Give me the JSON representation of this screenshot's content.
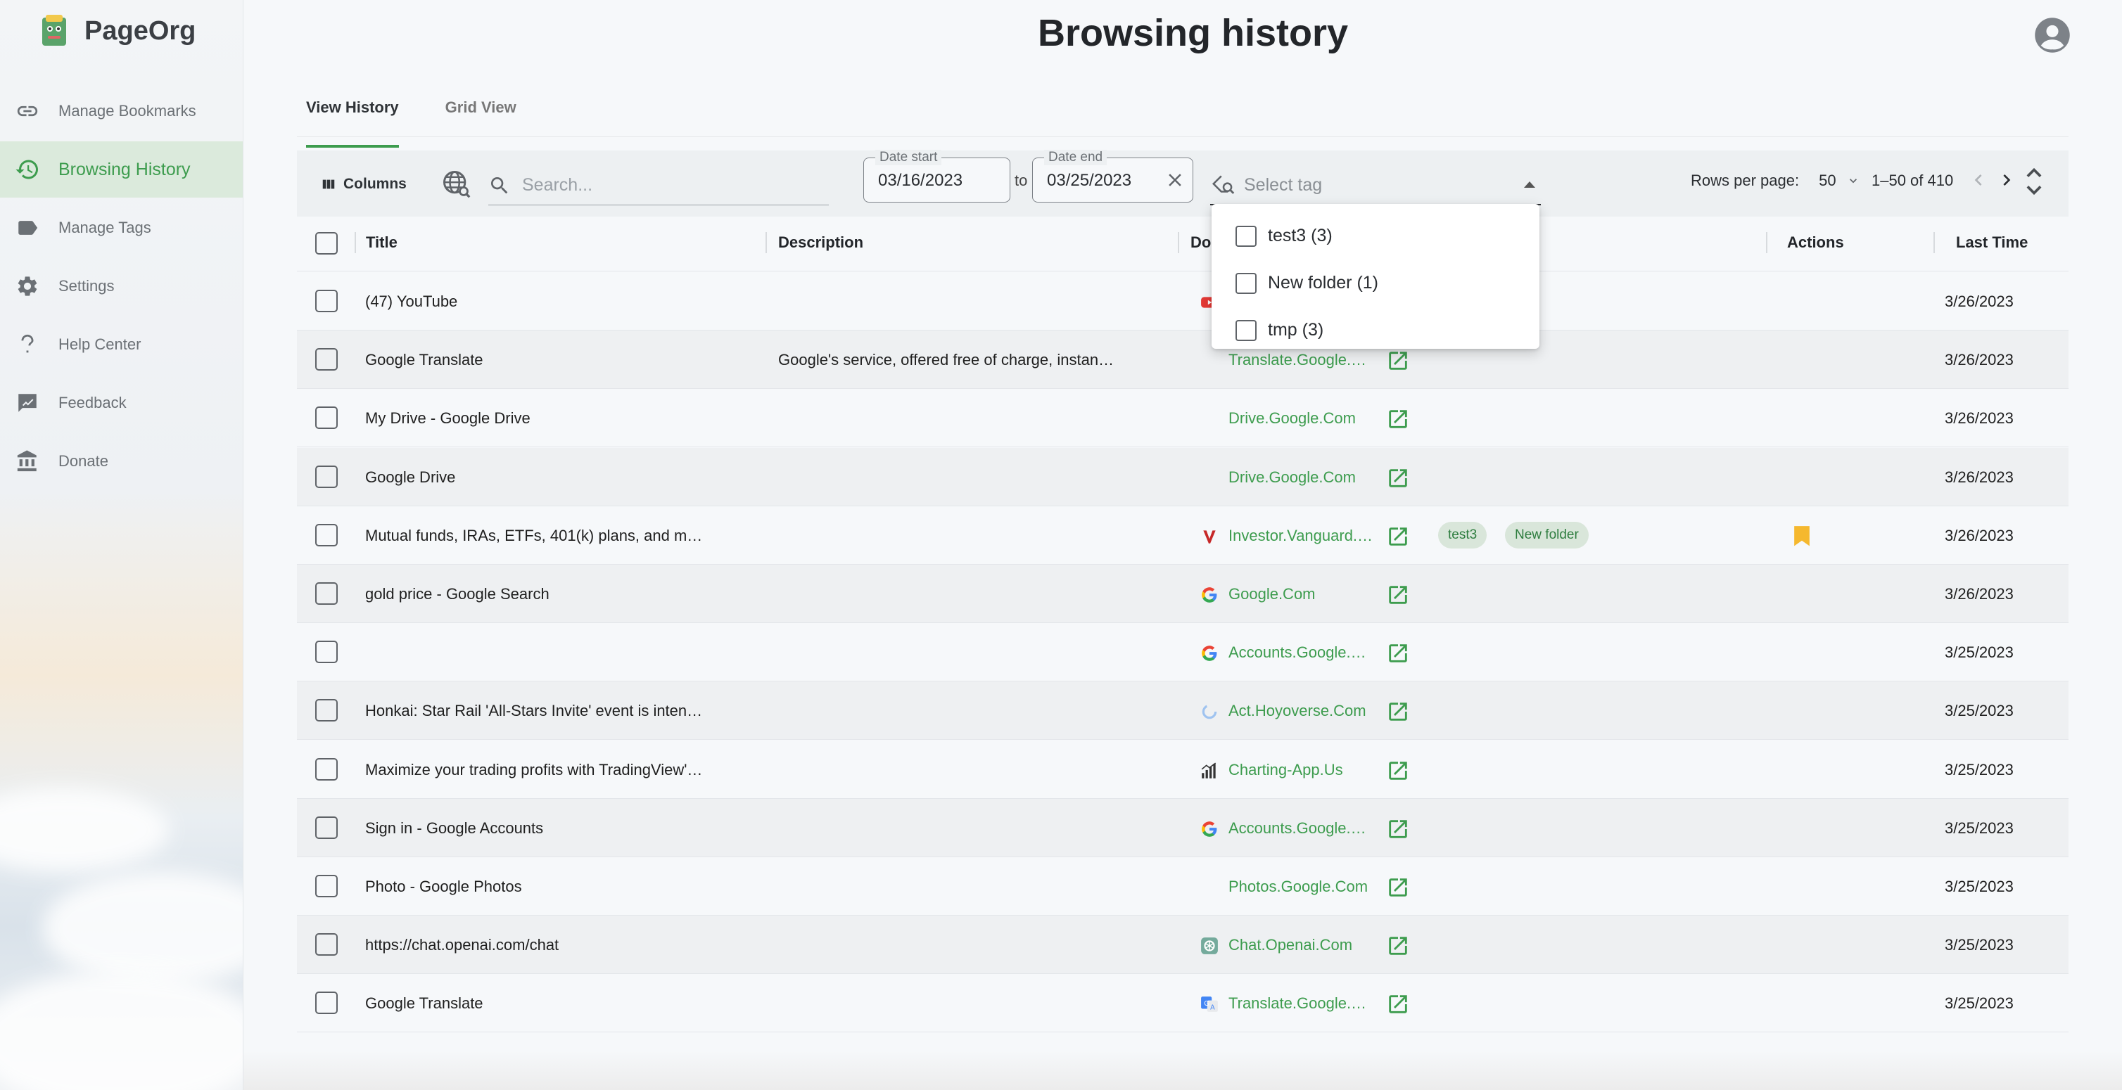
{
  "app": {
    "name": "PageOrg"
  },
  "nav": {
    "items": [
      {
        "label": "Manage Bookmarks",
        "icon": "link-icon",
        "active": false
      },
      {
        "label": "Browsing History",
        "icon": "history-icon",
        "active": true
      },
      {
        "label": "Manage Tags",
        "icon": "tag-icon",
        "active": false
      },
      {
        "label": "Settings",
        "icon": "gear-icon",
        "active": false
      },
      {
        "label": "Help Center",
        "icon": "question-icon",
        "active": false
      },
      {
        "label": "Feedback",
        "icon": "feedback-icon",
        "active": false
      },
      {
        "label": "Donate",
        "icon": "bank-icon",
        "active": false
      }
    ]
  },
  "header": {
    "title": "Browsing history"
  },
  "tabs": [
    {
      "label": "View History",
      "active": true
    },
    {
      "label": "Grid View",
      "active": false
    }
  ],
  "toolbar": {
    "columns_label": "Columns",
    "search_placeholder": "Search...",
    "date_start_label": "Date start",
    "date_start_value": "03/16/2023",
    "to_label": "to",
    "date_end_label": "Date end",
    "date_end_value": "03/25/2023",
    "tag_placeholder": "Select tag",
    "rows_per_page_label": "Rows per page:",
    "rows_per_page_value": "50",
    "range": "1–50 of 410"
  },
  "tag_dropdown": {
    "options": [
      "test3 (3)",
      "New folder (1)",
      "tmp (3)"
    ]
  },
  "table": {
    "columns": [
      "Title",
      "Description",
      "Do",
      "Actions",
      "Last Time"
    ],
    "rows": [
      {
        "title": "(47) YouTube",
        "description": "",
        "domain": "",
        "favicon": "youtube",
        "tags": [],
        "bookmarked": false,
        "last_time": "3/26/2023"
      },
      {
        "title": "Google Translate",
        "description": "Google's service, offered free of charge, instan…",
        "domain": "Translate.Google.…",
        "favicon": "",
        "tags": [],
        "bookmarked": false,
        "last_time": "3/26/2023"
      },
      {
        "title": "My Drive - Google Drive",
        "description": "",
        "domain": "Drive.Google.Com",
        "favicon": "",
        "tags": [],
        "bookmarked": false,
        "last_time": "3/26/2023"
      },
      {
        "title": "Google Drive",
        "description": "",
        "domain": "Drive.Google.Com",
        "favicon": "",
        "tags": [],
        "bookmarked": false,
        "last_time": "3/26/2023"
      },
      {
        "title": "Mutual funds, IRAs, ETFs, 401(k) plans, and m…",
        "description": "",
        "domain": "Investor.Vanguard.…",
        "favicon": "vanguard",
        "tags": [
          "test3",
          "New folder"
        ],
        "bookmarked": true,
        "last_time": "3/26/2023"
      },
      {
        "title": "gold price - Google Search",
        "description": "",
        "domain": "Google.Com",
        "favicon": "google",
        "tags": [],
        "bookmarked": false,
        "last_time": "3/26/2023"
      },
      {
        "title": "",
        "description": "",
        "domain": "Accounts.Google.…",
        "favicon": "google",
        "tags": [],
        "bookmarked": false,
        "last_time": "3/25/2023"
      },
      {
        "title": "Honkai: Star Rail 'All-Stars Invite' event is inten…",
        "description": "",
        "domain": "Act.Hoyoverse.Com",
        "favicon": "hoyoverse",
        "tags": [],
        "bookmarked": false,
        "last_time": "3/25/2023"
      },
      {
        "title": "Maximize your trading profits with TradingView'…",
        "description": "",
        "domain": "Charting-App.Us",
        "favicon": "chart",
        "tags": [],
        "bookmarked": false,
        "last_time": "3/25/2023"
      },
      {
        "title": "Sign in - Google Accounts",
        "description": "",
        "domain": "Accounts.Google.…",
        "favicon": "google",
        "tags": [],
        "bookmarked": false,
        "last_time": "3/25/2023"
      },
      {
        "title": "Photo - Google Photos",
        "description": "",
        "domain": "Photos.Google.Com",
        "favicon": "",
        "tags": [],
        "bookmarked": false,
        "last_time": "3/25/2023"
      },
      {
        "title": "https://chat.openai.com/chat",
        "description": "",
        "domain": "Chat.Openai.Com",
        "favicon": "openai",
        "tags": [],
        "bookmarked": false,
        "last_time": "3/25/2023"
      },
      {
        "title": "Google Translate",
        "description": "",
        "domain": "Translate.Google.…",
        "favicon": "translate",
        "tags": [],
        "bookmarked": false,
        "last_time": "3/25/2023"
      }
    ]
  },
  "colors": {
    "accent": "#3d9c4e",
    "active_bg": "#dbeadc",
    "chip_bg": "#d9e6da",
    "bookmark": "#f5b82e"
  }
}
